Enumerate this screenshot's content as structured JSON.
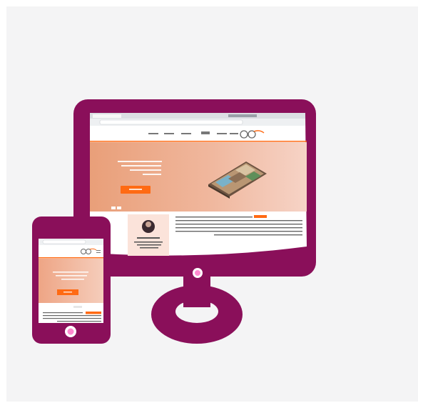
{
  "colors": {
    "frame": "#8a0f5a",
    "background": "#f4f4f5",
    "hero_start": "#e9a27f",
    "hero_end": "#f3ccbc",
    "accent": "#ff6a13",
    "button_glow": "#ff8ad0"
  },
  "illustration": {
    "devices": [
      "desktop-monitor",
      "smartphone"
    ],
    "subject": "responsive-real-estate-website"
  }
}
